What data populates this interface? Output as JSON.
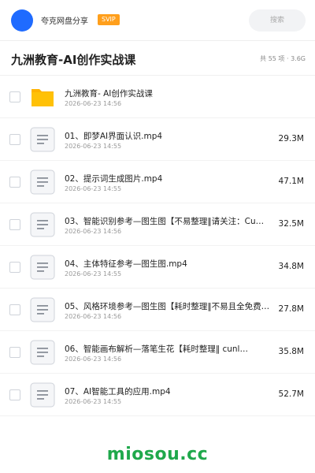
{
  "header": {
    "share_name": "夸克网盘分享",
    "badge": "SVIP",
    "search_placeholder": "搜索"
  },
  "folder": {
    "title": "九洲教育-AI创作实战课",
    "meta": "共 55 项 · 3.6G"
  },
  "colors": {
    "avatar": "#1f6bff",
    "svip_badge": "#ff9f1c",
    "folder_icon": "#ffc107",
    "watermark": "#1fa84b"
  },
  "items": [
    {
      "type": "folder",
      "icon": "folder-icon",
      "name": "九洲教育- AI创作实战课",
      "date": "2026-06-23 14:56",
      "size": ""
    },
    {
      "type": "file",
      "icon": "file-icon",
      "name": "01、即梦AI界面认识.mp4",
      "date": "2026-06-23 14:55",
      "size": "29.3M"
    },
    {
      "type": "file",
      "icon": "file-icon",
      "name": "02、提示词生成图片.mp4",
      "date": "2026-06-23 14:55",
      "size": "47.1M"
    },
    {
      "type": "file",
      "icon": "file-icon",
      "name": "03、智能识别参考—图生图【不易整理‖请关注：Cu…",
      "date": "2026-06-23 14:56",
      "size": "32.5M"
    },
    {
      "type": "file",
      "icon": "file-icon",
      "name": "04、主体特征参考—图生图.mp4",
      "date": "2026-06-23 14:55",
      "size": "34.8M"
    },
    {
      "type": "file",
      "icon": "file-icon",
      "name": "05、风格环境参考—图生图【耗时整理‖不易且全免费…",
      "date": "2026-06-23 14:56",
      "size": "27.8M"
    },
    {
      "type": "file",
      "icon": "file-icon",
      "name": "06、智能画布解析—落笔生花【耗时整理‖ cunl…",
      "date": "2026-06-23 14:56",
      "size": "35.8M"
    },
    {
      "type": "file",
      "icon": "file-icon",
      "name": "07、AI智能工具的应用.mp4",
      "date": "2026-06-23 14:55",
      "size": "52.7M"
    }
  ],
  "watermark": "miosou.cc"
}
